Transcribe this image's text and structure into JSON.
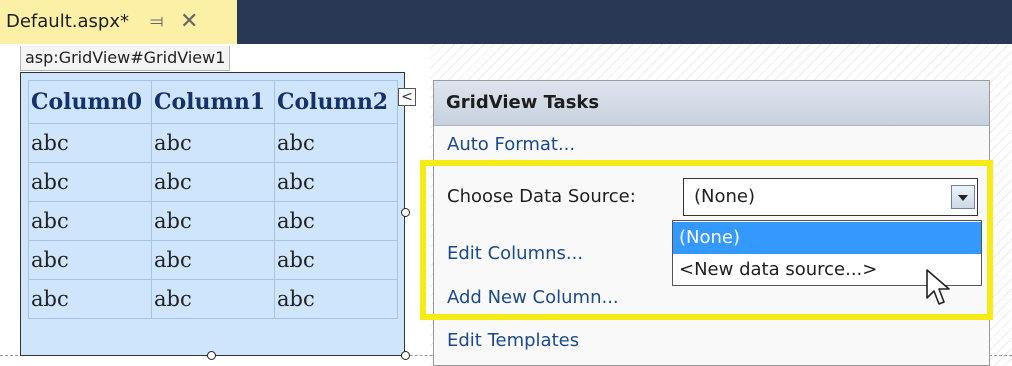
{
  "document_tab": {
    "title": "Default.aspx*",
    "pin_icon": "pin-icon",
    "close_icon": "close-icon"
  },
  "breadcrumb": "asp:GridView#GridView1",
  "grid": {
    "headers": [
      "Column0",
      "Column1",
      "Column2"
    ],
    "rows": [
      [
        "abc",
        "abc",
        "abc"
      ],
      [
        "abc",
        "abc",
        "abc"
      ],
      [
        "abc",
        "abc",
        "abc"
      ],
      [
        "abc",
        "abc",
        "abc"
      ],
      [
        "abc",
        "abc",
        "abc"
      ]
    ]
  },
  "smart_tag": {
    "glyph": "<"
  },
  "tasks_panel": {
    "title": "GridView Tasks",
    "auto_format": "Auto Format...",
    "choose_data_source_label": "Choose Data Source:",
    "data_source_value": "(None)",
    "data_source_options": [
      "(None)",
      "<New data source...>"
    ],
    "highlighted_option_index": 0,
    "edit_columns": "Edit Columns...",
    "add_new_column": "Add New Column...",
    "edit_templates": "Edit Templates"
  },
  "colors": {
    "tab_background": "#fbf0a6",
    "title_bar": "#293955",
    "grid_background": "#cfe5fb",
    "grid_header_text": "#153368",
    "highlight_box": "#f5ec15",
    "selected_option": "#3399ff",
    "link": "#1a4a8c"
  }
}
